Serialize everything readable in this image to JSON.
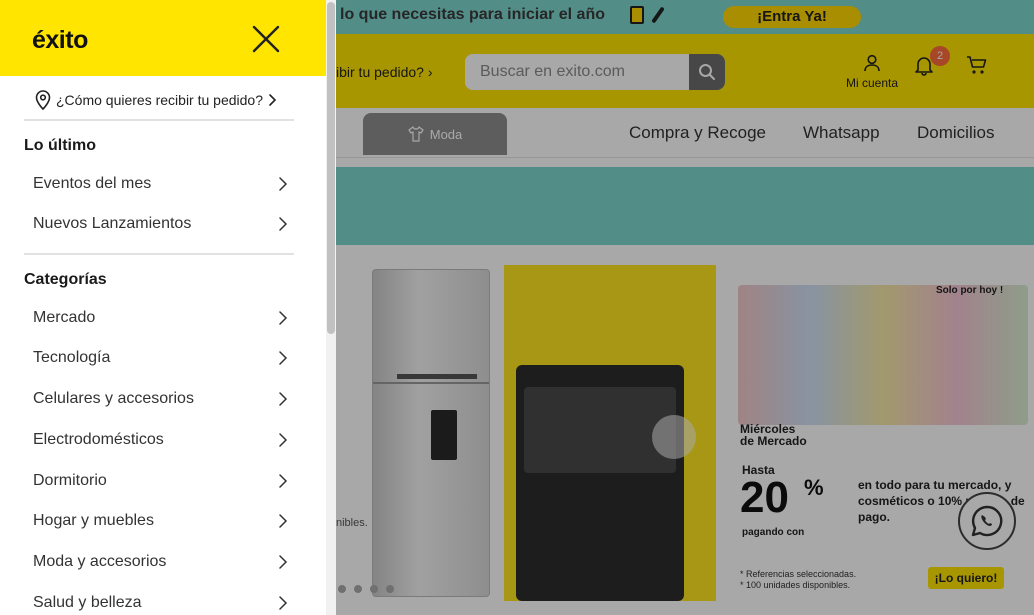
{
  "promo": {
    "text": "lo que necesitas para iniciar el año",
    "button": "¡Entra Ya!"
  },
  "header": {
    "pickup_partial": "ibir tu pedido?",
    "search_placeholder": "Buscar en exito.com",
    "account_label": "Mi cuenta",
    "notification_count": "2"
  },
  "nav": {
    "active_tab": "Moda",
    "links": [
      "Compra y Recoge",
      "Whatsapp",
      "Domicilios"
    ]
  },
  "hero": {
    "fine_print_partial": "nibles.",
    "panel3": {
      "solo": "Solo por hoy !",
      "miercoles": "Miércoles",
      "de_mercado": "de Mercado",
      "hasta": "Hasta",
      "discount": "20",
      "percent": "%",
      "desc": "en todo para tu mercado, y cosméticos o 10% medios de pago.",
      "pagando": "pagando con",
      "note1": "* Referencias seleccionadas.",
      "note2": "* 100 unidades disponibles.",
      "button": "¡Lo quiero!"
    }
  },
  "drawer": {
    "logo": "éxito",
    "pickup_question": "¿Cómo quieres recibir tu pedido?",
    "sections": [
      {
        "title": "Lo último",
        "items": [
          "Eventos del mes",
          "Nuevos Lanzamientos"
        ]
      },
      {
        "title": "Categorías",
        "items": [
          "Mercado",
          "Tecnología",
          "Celulares y accesorios",
          "Electrodomésticos",
          "Dormitorio",
          "Hogar y muebles",
          "Moda y accesorios",
          "Salud y belleza"
        ]
      }
    ]
  },
  "colors": {
    "brand_yellow": "#ffe500",
    "promo_teal": "#7fd6cf",
    "badge": "#ff6b3d"
  },
  "icons": [
    "close-icon",
    "location-pin-icon",
    "chevron-right-icon",
    "search-icon",
    "user-icon",
    "bell-icon",
    "cart-icon",
    "whatsapp-icon",
    "shirt-icon"
  ]
}
